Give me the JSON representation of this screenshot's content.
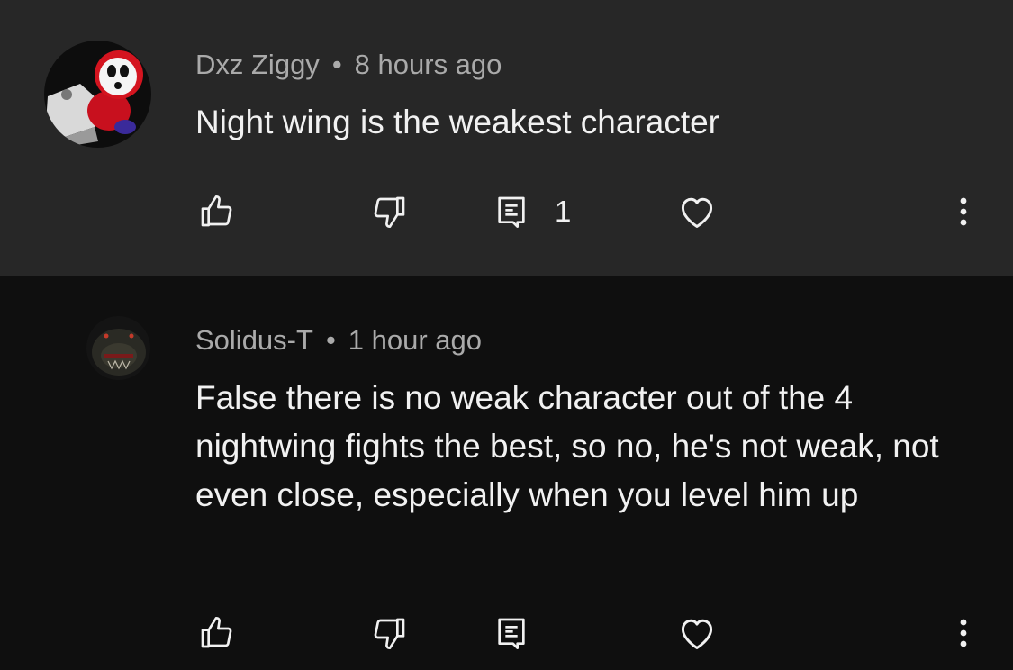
{
  "comments": [
    {
      "author": "Dxz Ziggy",
      "separator": "•",
      "time": "8 hours ago",
      "text": "Night wing is the weakest character",
      "reply_count": "1",
      "avatar_icon": "shy-guy-avatar-icon"
    },
    {
      "author": "Solidus-T",
      "separator": "•",
      "time": "1 hour ago",
      "text": "False there is no weak character out of the 4 nightwing fights the best, so no, he's not weak, not even close, especially when you level him up",
      "reply_count": "",
      "avatar_icon": "dark-creature-avatar-icon"
    }
  ],
  "colors": {
    "top_background": "#272727",
    "reply_background": "#0f0f0f",
    "meta_text": "#aaaaaa",
    "body_text": "#f1f1f1"
  },
  "icons": [
    "thumbs-up-icon",
    "thumbs-down-icon",
    "reply-icon",
    "heart-icon",
    "more-vert-icon"
  ]
}
